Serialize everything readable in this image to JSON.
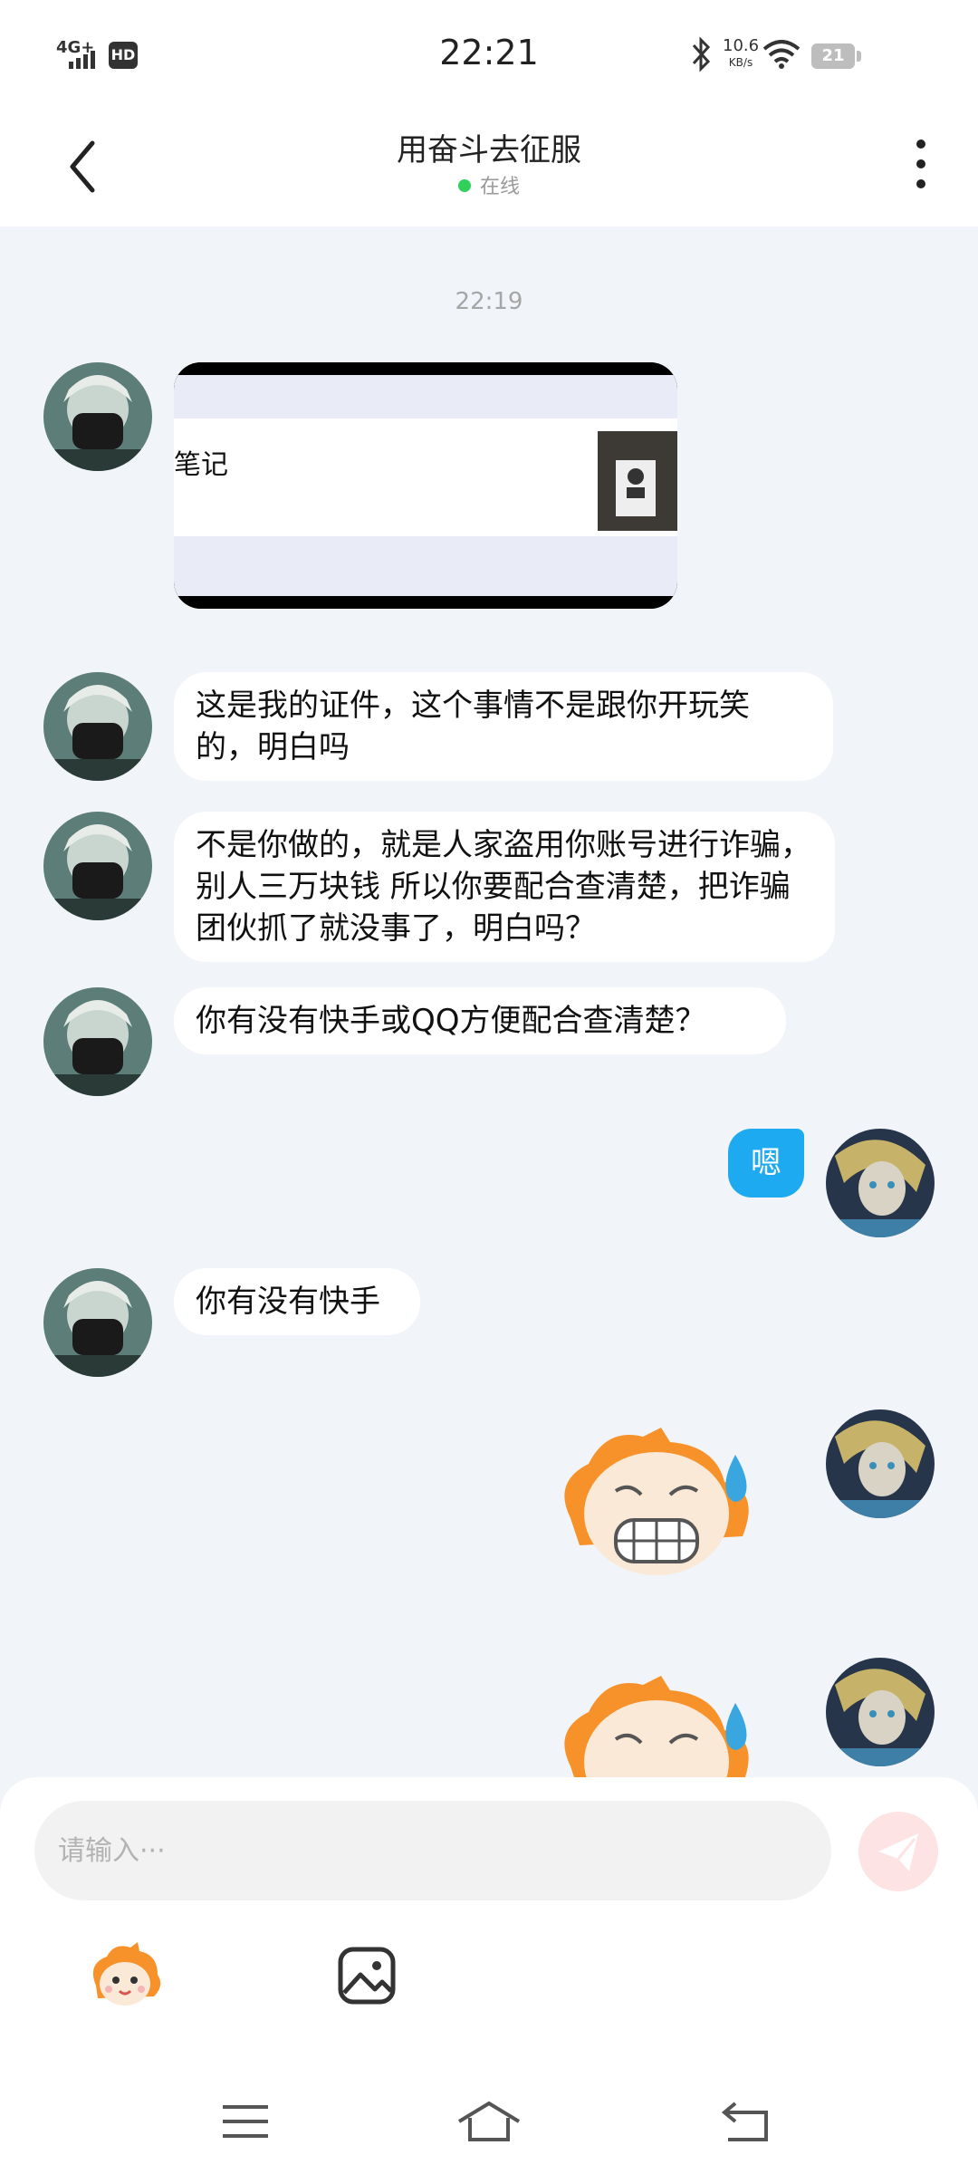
{
  "status_bar": {
    "network": "4G+",
    "hd": "HD",
    "time": "22:21",
    "speed_value": "10.6",
    "speed_unit": "KB/s",
    "battery": "21"
  },
  "header": {
    "title": "用奋斗去征服",
    "status": "在线"
  },
  "chat": {
    "timestamp": "22:19",
    "image_caption": "笔记",
    "messages": [
      {
        "from": "other",
        "text": "这是我的证件，这个事情不是跟你开玩笑的，明白吗"
      },
      {
        "from": "other",
        "text": "不是你做的，就是人家盗用你账号进行诈骗，别人三万块钱 所以你要配合查清楚，把诈骗团伙抓了就没事了，明白吗？"
      },
      {
        "from": "other",
        "text": "你有没有快手或QQ方便配合查清楚？"
      },
      {
        "from": "me",
        "text": "嗯"
      },
      {
        "from": "other",
        "text": "你有没有快手"
      }
    ]
  },
  "input": {
    "placeholder": "请输入···"
  },
  "colors": {
    "background": "#f1f4f9",
    "my_bubble": "#1eaaf1",
    "online_dot": "#2fd15a",
    "send_button": "#fde3e3"
  },
  "icons": [
    "back-icon",
    "more-icon",
    "send-icon",
    "emoji-icon",
    "image-icon",
    "menu-icon",
    "home-icon",
    "return-icon"
  ]
}
